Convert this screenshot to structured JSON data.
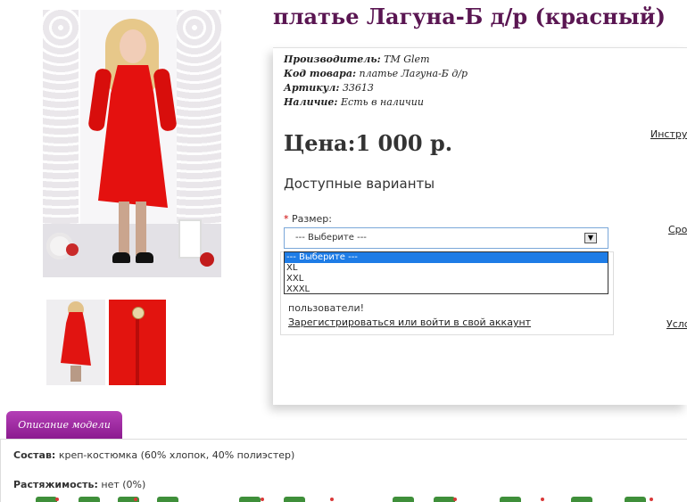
{
  "product": {
    "title": "платье Лагуна-Б д/р (красный)",
    "info": [
      {
        "label": "Производитель:",
        "value": "TM Glem"
      },
      {
        "label": "Код товара:",
        "value": "платье Лагуна-Б д/р"
      },
      {
        "label": "Артикул:",
        "value": "33613"
      },
      {
        "label": "Наличие:",
        "value": "Есть в наличии"
      }
    ],
    "price": "Цена:1 000 р.",
    "variants_heading": "Доступные варианты",
    "size_required_mark": "*",
    "size_label": "Размер:",
    "size_select_value": "--- Выберите ---",
    "size_options": [
      "--- Выберите ---",
      "XL",
      "XXL",
      "XXXL"
    ],
    "register_text": "пользователи!",
    "register_link": "Зарегистрироваться или войти в свой аккаунт"
  },
  "side_links": {
    "instruction": "Инстру",
    "delivery": "Срок",
    "conditions": "Услс"
  },
  "tabs": {
    "description": "Описание модели"
  },
  "description": {
    "composition_label": "Состав:",
    "composition_value": "креп-костюмка (60% хлопок, 40% полиэстер)",
    "stretch_label": "Растяжимость:",
    "stretch_value": "нет (0%)"
  },
  "colors": {
    "title": "#5a1652",
    "tab": "#8a1a8e",
    "dress": "#e4110f",
    "select_border": "#7aa7d9",
    "selected_option": "#1e7ce6"
  },
  "icons": {
    "select_arrow": "chevron-down-icon"
  }
}
